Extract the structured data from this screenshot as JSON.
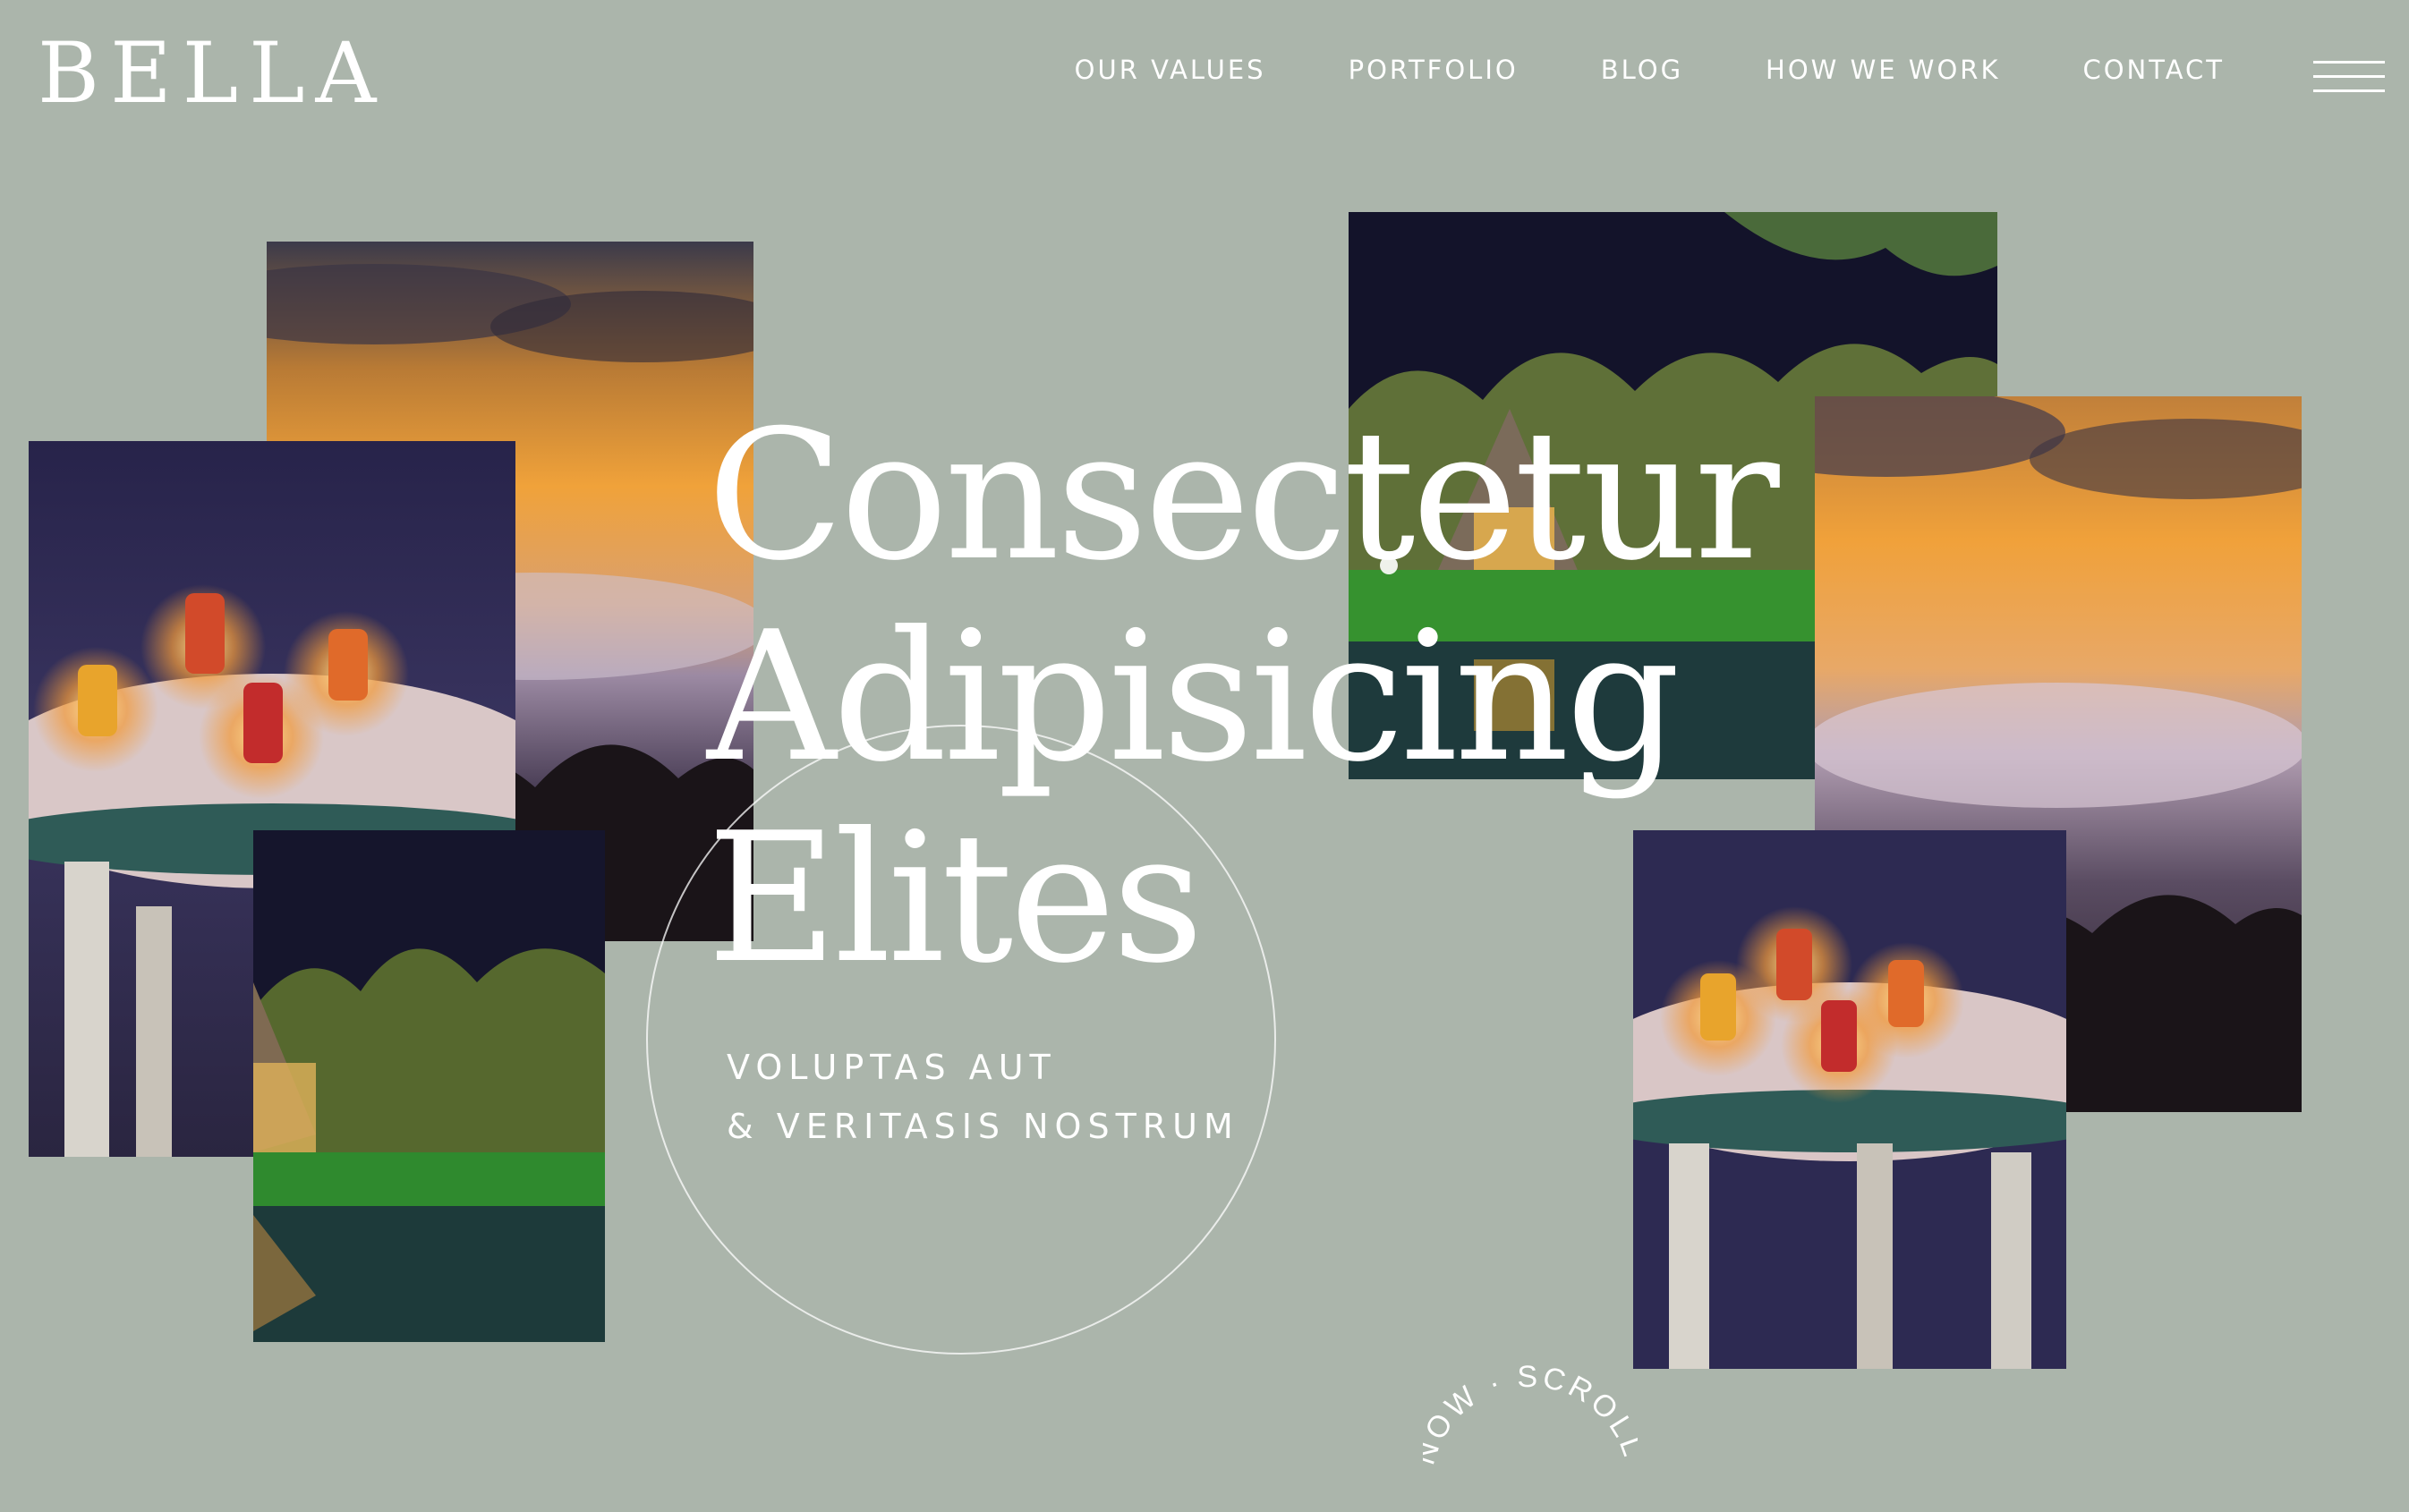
{
  "brand": {
    "logo": "BELLA"
  },
  "nav": {
    "items": [
      {
        "label": "OUR VALUES"
      },
      {
        "label": "PORTFOLIO"
      },
      {
        "label": "BLOG"
      },
      {
        "label": "HOW WE WORK"
      },
      {
        "label": "CONTACT"
      }
    ],
    "menu_icon": "hamburger-menu-icon"
  },
  "hero": {
    "title_lines": [
      "Consectetur",
      "Adipisicing",
      "Elites"
    ],
    "subtitle_lines": [
      "VOLUPTAS AUT",
      "& VERITASIS NOSTRUM"
    ]
  },
  "scroll_badge": {
    "text": "NOW · SCROLL"
  },
  "colors": {
    "background": "#abb5ab",
    "text": "#ffffff"
  }
}
